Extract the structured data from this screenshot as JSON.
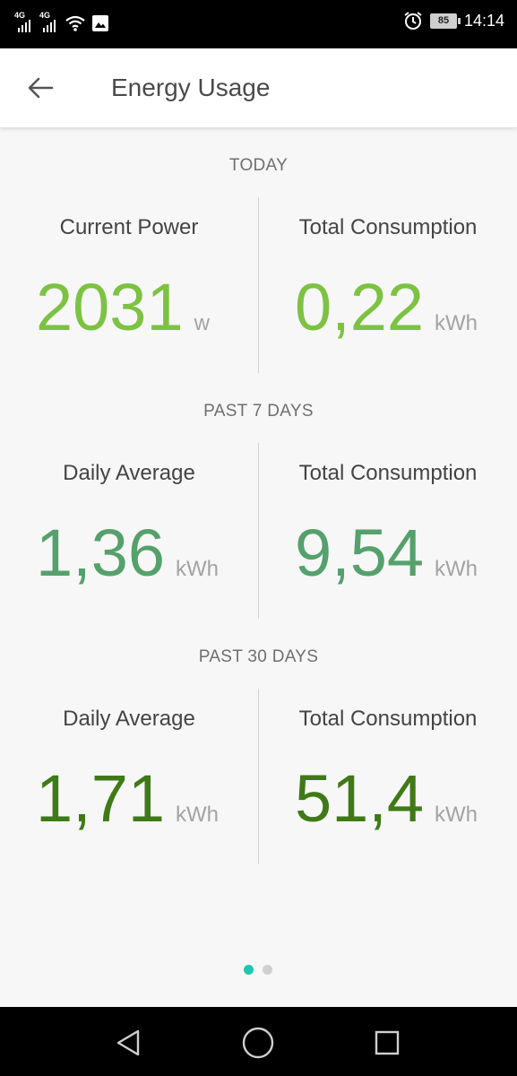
{
  "status_bar": {
    "network_1": "4G",
    "network_2": "4G",
    "battery": "85",
    "time": "14:14"
  },
  "header": {
    "title": "Energy Usage",
    "back_icon": "arrow-left-icon"
  },
  "sections": [
    {
      "label": "TODAY",
      "left": {
        "title": "Current Power",
        "value": "2031",
        "unit": "w"
      },
      "right": {
        "title": "Total Consumption",
        "value": "0,22",
        "unit": "kWh"
      },
      "color": "#7dc242"
    },
    {
      "label": "PAST 7 DAYS",
      "left": {
        "title": "Daily Average",
        "value": "1,36",
        "unit": "kWh"
      },
      "right": {
        "title": "Total Consumption",
        "value": "9,54",
        "unit": "kWh"
      },
      "color": "#55a16b"
    },
    {
      "label": "PAST 30 DAYS",
      "left": {
        "title": "Daily Average",
        "value": "1,71",
        "unit": "kWh"
      },
      "right": {
        "title": "Total Consumption",
        "value": "51,4",
        "unit": "kWh"
      },
      "color": "#3f7a16"
    }
  ],
  "pager": {
    "active_color": "#1ec7b0",
    "inactive_color": "#cfcfcf"
  },
  "nav": {
    "back": "back-triangle-icon",
    "home": "home-circle-icon",
    "recents": "recents-square-icon"
  }
}
